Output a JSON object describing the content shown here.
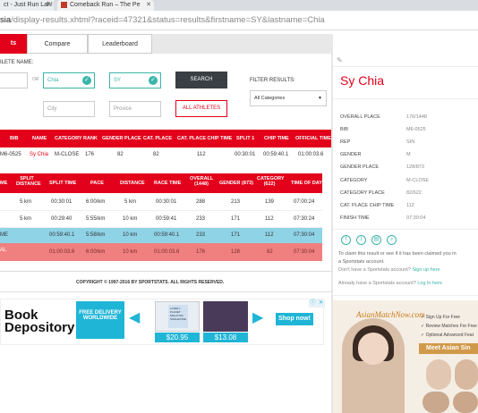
{
  "browser": {
    "tab1": "ct - Just Run Lah!",
    "tab2": "Comeback Run – The Pe",
    "address_host": "sia",
    "address_path": "/display-results.xhtml?raceid=47321&status=results&firstname=SY&lastname=Chia"
  },
  "nav": {
    "results": "ts",
    "compare": "Compare",
    "leaderboard": "Leaderboard"
  },
  "search": {
    "athlete_name_label": "ILETE NAME:",
    "or": "OR",
    "lastname_value": "Chia",
    "firstname_value": "SY",
    "city_placeholder": "City",
    "province_placeholder": "Provice",
    "search_button": "SEARCH",
    "all_athletes_button": "ALL ATHLETES",
    "filter_label": "FILTER RESULTS:",
    "filter_value": "All Categories"
  },
  "results_table": {
    "headers": [
      "BIB",
      "NAME",
      "CATEGORY",
      "RANK",
      "GENDER PLACE",
      "CAT. PLACE",
      "CAT. PLACE CHIP TIME",
      "SPLIT 1",
      "CHIP TIME",
      "OFFICIAL TIME"
    ],
    "row": [
      "M6-0525",
      "Sy Chia",
      "M-CLOSE",
      "176",
      "82",
      "82",
      "112",
      "00:30:01",
      "00:59:40.1",
      "01:00:03.6"
    ]
  },
  "split_table": {
    "headers": [
      "ME",
      "SPLIT DISTANCE",
      "SPLIT TIME",
      "PACE",
      "DISTANCE",
      "RACE TIME",
      "OVERALL (1448)",
      "GENDER (873)",
      "CATEGORY (622)",
      "TIME OF DAY"
    ],
    "rows": [
      [
        "",
        "5 km",
        "00:30:01",
        "6:00/km",
        "5 km",
        "00:30:01",
        "288",
        "213",
        "139",
        "07:00:24"
      ],
      [
        "",
        "5 km",
        "00:29:40",
        "5:55/km",
        "10 km",
        "00:59:41",
        "233",
        "171",
        "112",
        "07:30:24"
      ],
      [
        "ME",
        "",
        "00:59:40.1",
        "5:58/km",
        "10 km",
        "00:59:40.1",
        "233",
        "171",
        "112",
        "07:30:04"
      ],
      [
        "AL",
        "",
        "01:00:03.6",
        "6:00/km",
        "10 km",
        "01:00:03.6",
        "176",
        "128",
        "82",
        "07:30:04"
      ]
    ]
  },
  "footer": {
    "copyright": "COPYRIGHT © 1997-2016 BY SPORTSTATS. ALL RIGHTS RESERVED."
  },
  "ad_left": {
    "brand_line1": "Book",
    "brand_line2": "Depository",
    "free_delivery": "FREE DELIVERY WORLDWIDE",
    "price1": "$20.95",
    "price2": "$13.08",
    "shop_now": "Shop now!",
    "book1_title": "LONELY PLANET MALAYSIA SINGAPORE"
  },
  "profile": {
    "name": "Sy Chia",
    "fields": [
      [
        "OVERALL PLACE",
        "176/1448"
      ],
      [
        "BIB",
        "M6-0525"
      ],
      [
        "REP",
        "SIN"
      ],
      [
        "GENDER",
        "M"
      ],
      [
        "GENDER PLACE",
        "128/873"
      ],
      [
        "CATEGORY",
        "M-CLOSE"
      ],
      [
        "CATEGORY PLACE",
        "82/622"
      ],
      [
        "CAT. PLACE CHIP TIME",
        "112"
      ],
      [
        "FINISH TIME",
        "07:30:04"
      ]
    ],
    "claim_text": "To claim this result or see if it has been claimed you m",
    "claim_text2": "a Sportstats account.",
    "no_account": "Don't have a Sportstats account?",
    "signup": "Sign up here",
    "have_account": "Already have a Sportstats account?",
    "login": "Log in here"
  },
  "ad_right": {
    "logo": "AsianMatchNow.com",
    "bullets": [
      "Sign Up For Free",
      "Review Matches For Free",
      "Optional Advanced Feat"
    ],
    "cta": "Meet Asian Sin"
  },
  "colors": {
    "accent": "#e3001b",
    "teal": "#3ab5a9",
    "highlight_row": "#8fd3e6",
    "total_row": "#f08080"
  }
}
